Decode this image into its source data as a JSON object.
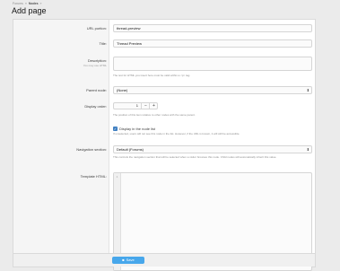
{
  "breadcrumb": {
    "items": [
      "Forums",
      "Nodes"
    ],
    "separator": "»"
  },
  "page_title": "Add page",
  "form": {
    "url_portion": {
      "label": "URL portion:",
      "value": "thread-preview"
    },
    "title": {
      "label": "Title:",
      "value": "Thread Preview"
    },
    "description": {
      "label": "Description:",
      "sublabel": "You may use HTML",
      "value": "",
      "hint": "The text for HTML you insert here must be valid within a <p> tag."
    },
    "parent_node": {
      "label": "Parent node:",
      "value": "(None)"
    },
    "display_order": {
      "label": "Display order:",
      "value": "1",
      "decrement": "−",
      "increment": "+",
      "hint": "The position of this item relative to other nodes with the same parent."
    },
    "display_in_list": {
      "label": "Display in the node list",
      "checked": true,
      "hint": "If unselected, users will not see this node in the list. However, if the URL is known, it will still be accessible."
    },
    "navigation_section": {
      "label": "Navigation section:",
      "value": "Default (Forums)",
      "hint": "This controls the navigation section that will be selected when a visitor browses this node. Child nodes will automatically inherit this value."
    },
    "template_html": {
      "label": "Template HTML:",
      "line_number": "1"
    }
  },
  "footer": {
    "save_label": "Save",
    "save_icon": "save-icon"
  },
  "colors": {
    "background": "#ebebeb",
    "panel": "#ffffff",
    "label_column": "#f5f5f5",
    "save_button": "#47a7eb",
    "checkbox": "#3f7fc1"
  }
}
